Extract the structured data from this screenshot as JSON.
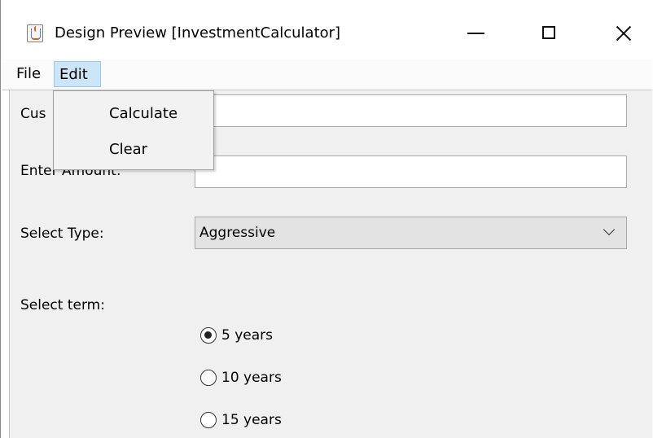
{
  "window": {
    "title": "Design Preview [InvestmentCalculator]",
    "app_icon": "java-cup-icon",
    "controls": [
      "minimize-icon",
      "maximize-icon",
      "close-icon"
    ]
  },
  "menubar": {
    "items": [
      {
        "label": "File"
      },
      {
        "label": "Edit",
        "active": true
      }
    ]
  },
  "edit_menu": {
    "items": [
      {
        "label": "Calculate"
      },
      {
        "label": "Clear"
      }
    ]
  },
  "form": {
    "customer_label": "Cus",
    "customer_value": "",
    "amount_label": "Enter Amount:",
    "amount_value": "",
    "type_label": "Select Type:",
    "type_value": "Aggressive",
    "term_label": "Select term:",
    "terms": [
      {
        "label": "5 years",
        "selected": true
      },
      {
        "label": "10 years",
        "selected": false
      },
      {
        "label": "15 years",
        "selected": false
      }
    ]
  },
  "colors": {
    "menu_highlight": "#cde6f7",
    "panel_bg": "#f0f0f0",
    "combo_bg": "#e3e3e3"
  }
}
